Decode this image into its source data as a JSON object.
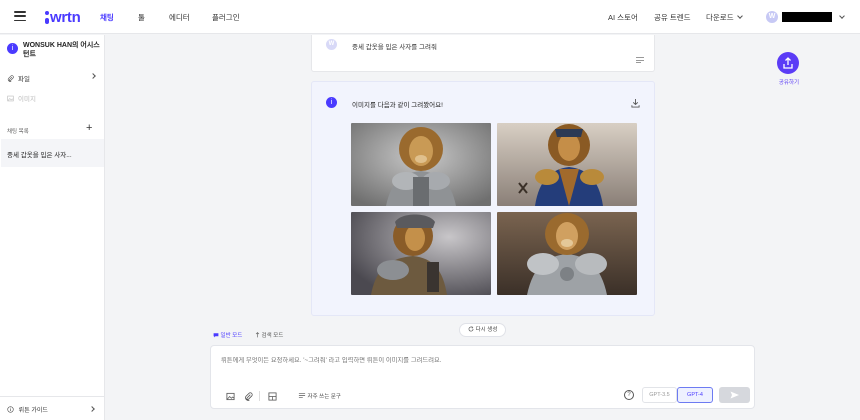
{
  "brand": {
    "logo_text": "wrtn",
    "accent": "#4a3aff"
  },
  "header": {
    "tabs": [
      {
        "label": "채팅",
        "active": true
      },
      {
        "label": "툴",
        "active": false
      },
      {
        "label": "에디터",
        "active": false
      },
      {
        "label": "플러그인",
        "active": false
      }
    ],
    "right": {
      "ai_store": "AI 스토어",
      "shared_trends": "공유 트렌드",
      "download": "다운로드",
      "avatar_initial": "W"
    }
  },
  "sidebar": {
    "assistant_name": "WONSUK HAN의 어시스턴트",
    "files_label": "파일",
    "images_label": "이미지",
    "chat_list_label": "채팅 목록",
    "chat_items": [
      "중세 갑옷을 입은 사자..."
    ],
    "guide_label": "뤼튼 가이드"
  },
  "conversation": {
    "user_initial": "W",
    "user_message": "중세 갑옷을 입은 사자를 그려줘",
    "bot_message": "이미지를 다음과 같이 그려봤어요!",
    "images": [
      {
        "subject": "lion-knight-silver-armor"
      },
      {
        "subject": "lion-knight-blue-coat"
      },
      {
        "subject": "lion-knight-helmet-dark"
      },
      {
        "subject": "lion-knight-plate-armor"
      }
    ]
  },
  "share": {
    "label": "공유하기"
  },
  "composer": {
    "regenerate": "다시 생성",
    "mode_general": "일반 모드",
    "mode_search": "검색 모드",
    "placeholder": "뤼튼에게 무엇이든 요청하세요. '~그려줘' 라고 입력하면 뤼튼이 이미지를 그려드려요.",
    "frequent_phrases": "자주 쓰는 문구",
    "help": "?",
    "model_gpt35": "GPT-3.5",
    "model_gpt4": "GPT-4"
  }
}
